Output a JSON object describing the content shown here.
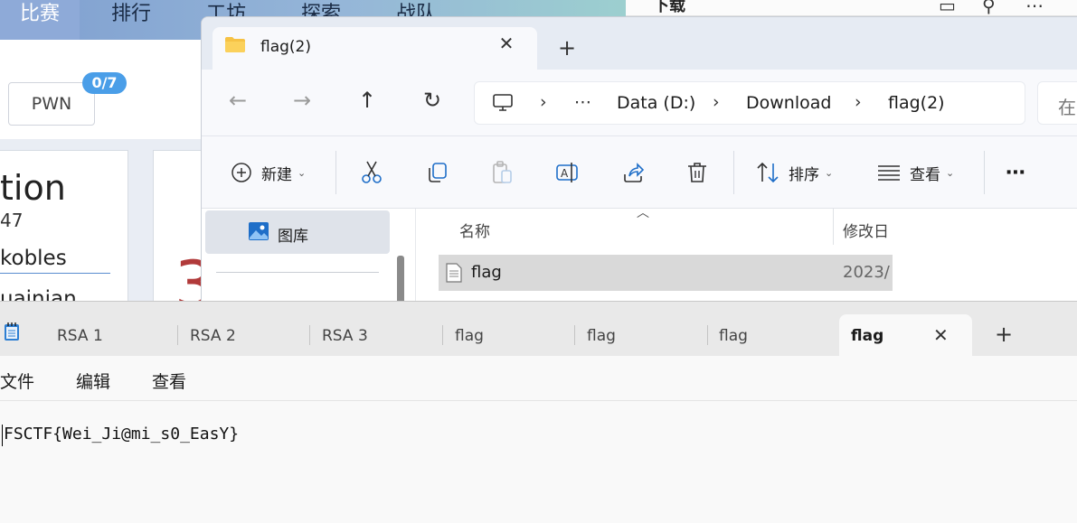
{
  "background_page": {
    "nav_items": [
      "比赛",
      "排行",
      "工坊",
      "探索",
      "战队"
    ],
    "category_button": "PWN",
    "category_badge": "0/7",
    "card_title_fragment": "tion",
    "card_subtitle_fragment": "47",
    "card_author_fragment": "kobles",
    "card_author2_fragment": "uainian",
    "card_digit_fragment": "3",
    "right_window_title": "下载"
  },
  "explorer": {
    "tab_title": "flag(2)",
    "breadcrumb": [
      "Data (D:)",
      "Download",
      "flag(2)"
    ],
    "search_placeholder": "在",
    "toolbar": {
      "new_label": "新建",
      "sort_label": "排序",
      "view_label": "查看"
    },
    "nav_pane": {
      "gallery_label": "图库"
    },
    "columns": {
      "name": "名称",
      "modified": "修改日"
    },
    "files": [
      {
        "name": "flag",
        "modified": "2023/"
      }
    ]
  },
  "notepad": {
    "tabs": [
      {
        "label": "RSA 1"
      },
      {
        "label": "RSA 2"
      },
      {
        "label": "RSA 3"
      },
      {
        "label": "flag"
      },
      {
        "label": "flag"
      },
      {
        "label": "flag"
      },
      {
        "label": "flag",
        "active": true
      }
    ],
    "menu": {
      "file": "文件",
      "edit": "编辑",
      "view": "查看"
    },
    "content": "FSCTF{Wei_Ji@mi_s0_EasY}"
  },
  "colors": {
    "badge": "#4a9ee8",
    "folder": "#f6c244",
    "accent": "#1e6ec8"
  }
}
